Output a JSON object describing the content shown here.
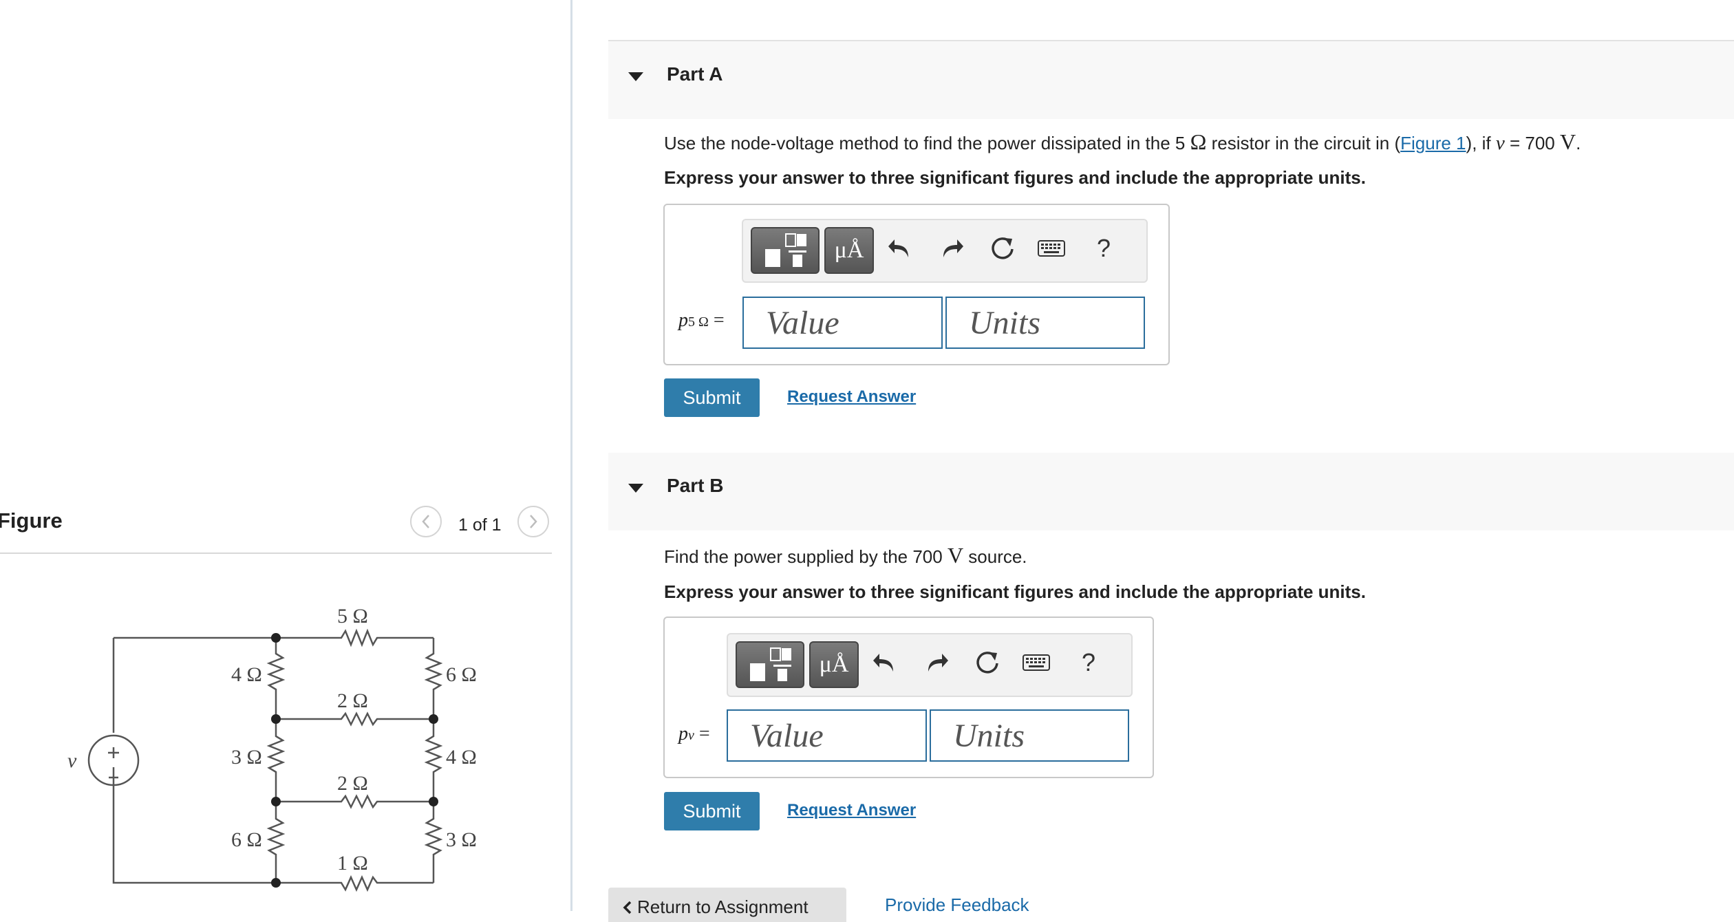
{
  "figure_pane": {
    "title": "Figure",
    "pager_text": "1 of 1",
    "circuit": {
      "source_label": "v",
      "source_plus": "+",
      "resistors": {
        "top_series": "5 Ω",
        "left_upper": "4 Ω",
        "left_middle": "3 Ω",
        "left_lower": "6 Ω",
        "mid_upper": "2 Ω",
        "mid_lower": "2 Ω",
        "bottom_series": "1 Ω",
        "right_upper": "6 Ω",
        "right_middle": "4 Ω",
        "right_lower": "3 Ω"
      }
    }
  },
  "part_a": {
    "title": "Part A",
    "prompt_before_r": "Use the node-voltage method to find the power dissipated in the 5 ",
    "prompt_omega": "Ω",
    "prompt_mid": " resistor in the circuit in (",
    "prompt_link": "Figure 1",
    "prompt_after_link": "), if ",
    "prompt_var": "v",
    "prompt_eq": " = 700 ",
    "prompt_unit": "V",
    "prompt_end": ".",
    "instruction": "Express your answer to three significant figures and include the appropriate units.",
    "var_symbol": "p",
    "var_subscript": "5 Ω",
    "var_equals": " =",
    "value_placeholder": "Value",
    "units_placeholder": "Units",
    "toolbar_units_glyph": "μÅ",
    "toolbar_help": "?",
    "submit_label": "Submit",
    "request_label": "Request Answer"
  },
  "part_b": {
    "title": "Part B",
    "prompt_before": "Find the power supplied by the 700 ",
    "prompt_unit": "V",
    "prompt_end": " source.",
    "instruction": "Express your answer to three significant figures and include the appropriate units.",
    "var_symbol": "p",
    "var_subscript": "v",
    "var_equals": " =",
    "value_placeholder": "Value",
    "units_placeholder": "Units",
    "toolbar_units_glyph": "μÅ",
    "toolbar_help": "?",
    "submit_label": "Submit",
    "request_label": "Request Answer"
  },
  "footer": {
    "return_label": "Return to Assignment",
    "feedback_label": "Provide Feedback"
  },
  "colors": {
    "accent": "#2f7dab",
    "link": "#1a6aa8",
    "input_border": "#2a6d9c",
    "toolbar_button": "#666666"
  }
}
